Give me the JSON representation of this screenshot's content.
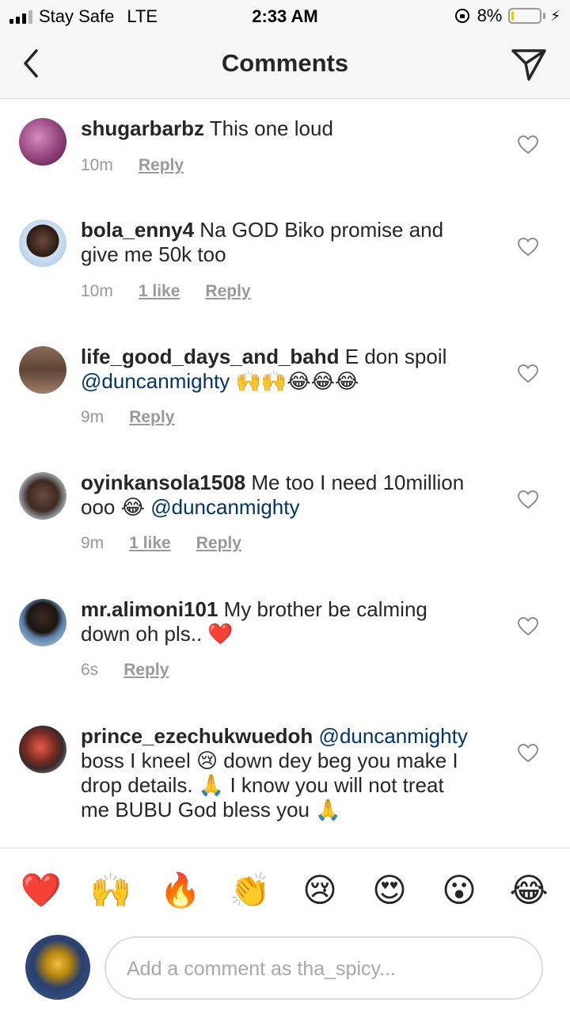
{
  "status_bar": {
    "carrier": "Stay Safe",
    "network": "LTE",
    "time": "2:33 AM",
    "battery_percent": "8%",
    "battery_level": 0.08
  },
  "header": {
    "title": "Comments",
    "back_icon": "chevron-left-icon",
    "send_icon": "paper-plane-icon"
  },
  "comments": [
    {
      "username": "shugarbarbz",
      "text": "This one loud",
      "time": "10m",
      "likes": "",
      "reply": "Reply"
    },
    {
      "username": "bola_enny4",
      "text": "Na GOD Biko promise and give me 50k too",
      "time": "10m",
      "likes": "1 like",
      "reply": "Reply"
    },
    {
      "username": "life_good_days_and_bahd",
      "text": "E don spoil",
      "mention": "@duncanmighty",
      "emojis": "🙌🙌😂😂😂",
      "time": "9m",
      "likes": "",
      "reply": "Reply"
    },
    {
      "username": "oyinkansola1508",
      "text": "Me too I need 10million ooo 😂",
      "mention": "@duncanmighty",
      "time": "9m",
      "likes": "1 like",
      "reply": "Reply"
    },
    {
      "username": "mr.alimoni101",
      "text": "My brother be calming down oh pls.. ❤️",
      "time": "6s",
      "likes": "",
      "reply": "Reply"
    },
    {
      "username": "prince_ezechukwuedoh",
      "mention": "@duncanmighty",
      "text": "boss I kneel 😢 down dey beg you make I drop details. 🙏 I know you will not treat me BUBU God bless you 🙏"
    }
  ],
  "reactions": [
    "❤️",
    "🙌",
    "🔥",
    "👏",
    "😢",
    "😍",
    "😮",
    "😂"
  ],
  "composer": {
    "placeholder": "Add a comment as tha_spicy..."
  },
  "colors": {
    "mention": "#003569",
    "meta": "#999999",
    "battery": "#f5c518"
  }
}
